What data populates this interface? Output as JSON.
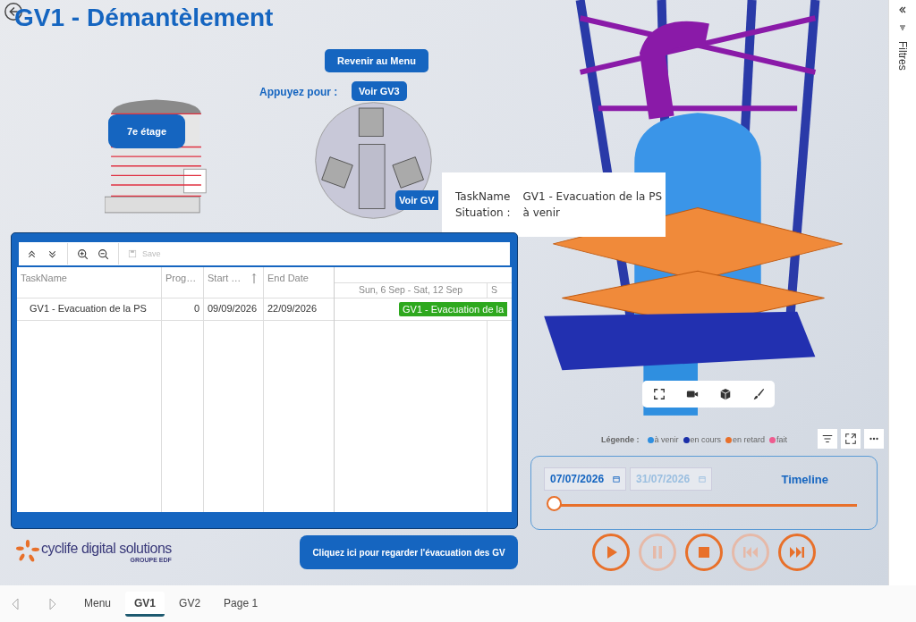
{
  "title": "GV1 - Démantèlement",
  "menu_button": "Revenir au Menu",
  "prompt": "Appuyez pour :",
  "view_buttons": [
    "Voir GV3",
    "Voir GV"
  ],
  "floor_label": "7e étage",
  "gantt": {
    "toolbar": {
      "save": "Save",
      "save_disabled": true
    },
    "columns": [
      "TaskName",
      "Prog…",
      "Start …",
      "End Date"
    ],
    "weeks": [
      "Sun, 6 Sep - Sat, 12 Sep",
      "S"
    ],
    "rows": [
      {
        "task": "GV1 - Evacuation de la PS",
        "progress": "0",
        "start": "09/09/2026",
        "end": "22/09/2026",
        "bar": "GV1 - Evacuation de la"
      }
    ]
  },
  "tooltip": [
    {
      "label": "TaskName",
      "value": "GV1 - Evacuation de la PS"
    },
    {
      "label": "Situation :",
      "value": "à venir"
    }
  ],
  "legend": {
    "label": "Légende :",
    "items": [
      {
        "label": "à venir",
        "color": "#2f8fe0"
      },
      {
        "label": "en cours",
        "color": "#1a2ea8"
      },
      {
        "label": "en retard",
        "color": "#e8702a"
      },
      {
        "label": "fait",
        "color": "#ee5c8f"
      }
    ]
  },
  "timeline": {
    "start": "07/07/2026",
    "end": "31/07/2026",
    "end_disabled": true,
    "title": "Timeline",
    "level": 0
  },
  "playback": [
    {
      "kind": "play",
      "disabled": false
    },
    {
      "kind": "pause",
      "disabled": true
    },
    {
      "kind": "stop",
      "disabled": false
    },
    {
      "kind": "previous",
      "disabled": true
    },
    {
      "kind": "next",
      "disabled": false
    }
  ],
  "logo": {
    "name": "cyclife digital solutions",
    "group": "GROUPE EDF"
  },
  "cta_button": "Cliquez ici pour regarder l'évacuation des GV",
  "page_tabs": [
    {
      "label": "Menu",
      "selected": false
    },
    {
      "label": "GV1",
      "selected": true
    },
    {
      "label": "GV2",
      "selected": false
    },
    {
      "label": "Page 1",
      "selected": false
    }
  ],
  "filters_pane": "Filtres"
}
